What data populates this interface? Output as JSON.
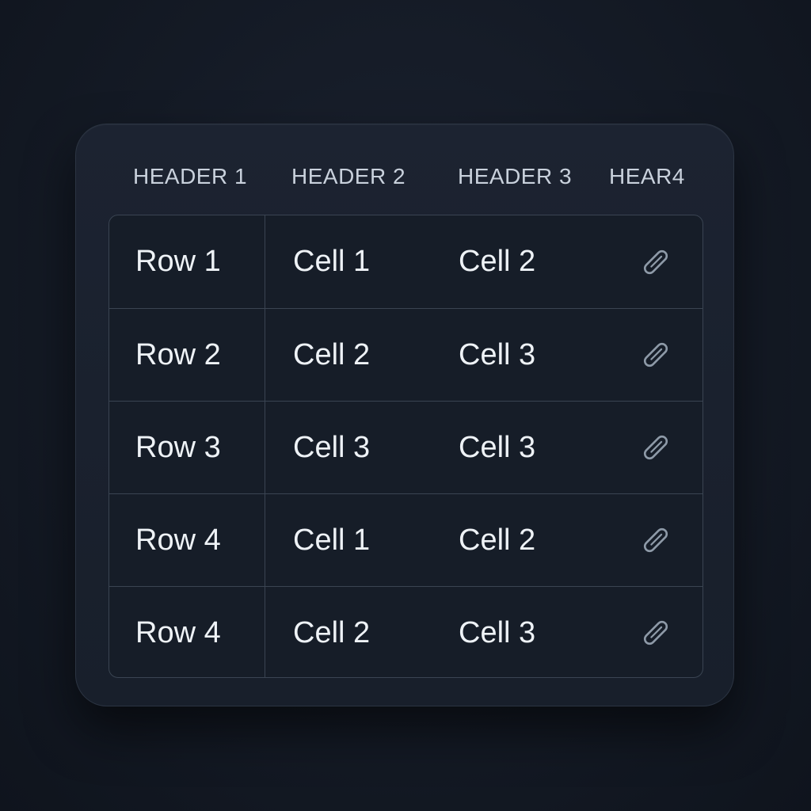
{
  "table": {
    "headers": [
      "HEADER 1",
      "HEADER 2",
      "HEADER 3",
      "HEAR4"
    ],
    "rows": [
      {
        "label": "Row 1",
        "col2": "Cell 1",
        "col3": "Cell 2",
        "action_icon": "paperclip-icon"
      },
      {
        "label": "Row 2",
        "col2": "Cell 2",
        "col3": "Cell 3",
        "action_icon": "paperclip-icon"
      },
      {
        "label": "Row 3",
        "col2": "Cell 3",
        "col3": "Cell 3",
        "action_icon": "paperclip-icon"
      },
      {
        "label": "Row 4",
        "col2": "Cell 1",
        "col3": "Cell 2",
        "action_icon": "paperclip-icon"
      },
      {
        "label": "Row 4",
        "col2": "Cell 2",
        "col3": "Cell 3",
        "action_icon": "paperclip-icon"
      }
    ]
  },
  "colors": {
    "background": "#141a25",
    "card": "#1a2130",
    "header_text": "#c9d1dc",
    "cell_text": "#eef2f6",
    "icon": "#8e9aa8",
    "border": "#3a4452"
  }
}
